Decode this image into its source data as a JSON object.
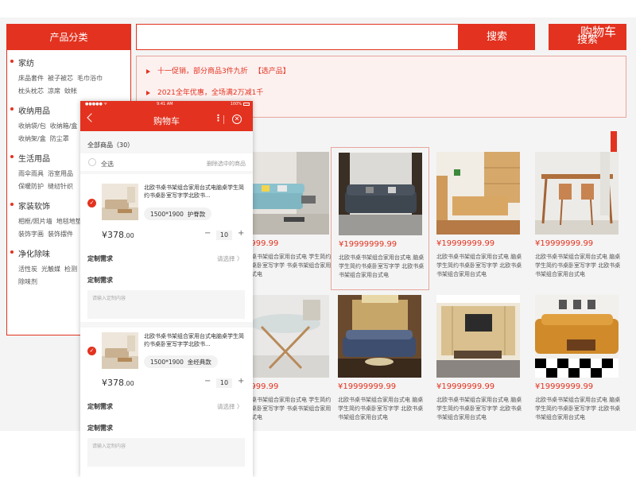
{
  "sidebar": {
    "header": "产品分类",
    "categories": [
      {
        "title": "家纺",
        "rows": [
          [
            "床品套件",
            "被子被芯",
            "毛巾浴巾"
          ],
          [
            "枕头枕芯",
            "凉席",
            "蚊帐"
          ]
        ]
      },
      {
        "title": "收纳用品",
        "rows": [
          [
            "收纳袋/包",
            "收纳箱/盒"
          ],
          [
            "收纳架/盒",
            "防尘罩"
          ]
        ]
      },
      {
        "title": "生活用品",
        "rows": [
          [
            "雨伞雨具",
            "浴室用品"
          ],
          [
            "保暖防护",
            "缝纫针织"
          ]
        ]
      },
      {
        "title": "家装软饰",
        "rows": [
          [
            "相框/照片墙",
            "地毯地垫"
          ],
          [
            "装饰字画",
            "装饰摆件"
          ]
        ]
      },
      {
        "title": "净化除味",
        "rows": [
          [
            "活性炭",
            "光触媒",
            "检测"
          ],
          [
            "除味剂"
          ]
        ]
      }
    ]
  },
  "search": {
    "placeholder": "",
    "button": "搜索"
  },
  "cart_button": {
    "label": "购物车",
    "ghost_label": "搜索"
  },
  "promos": [
    {
      "text": "十一促销，部分商品3件九折",
      "link": "【选产品】"
    },
    {
      "text": "2021全年优惠，全场满2万减1千",
      "link": ""
    }
  ],
  "products": [
    {
      "price": "9999.99",
      "desc": "书桌书架组合家用台式电 学生简约书桌卧室写字学 书桌书架组合家用台式电",
      "photo": "sofa-blue"
    },
    {
      "price": "¥19999999.99",
      "desc": "北欧书桌书架组合家用台式电 脑桌学生简约书桌卧室写字学 北欧书桌书架组合家用台式电",
      "photo": "sofa-dark"
    },
    {
      "price": "¥19999999.99",
      "desc": "北欧书桌书架组合家用台式电 脑桌学生简约书桌卧室写字学 北欧书桌书架组合家用台式电",
      "photo": "wood-cabinet"
    },
    {
      "price": "¥19999999.99",
      "desc": "北欧书桌书架组合家用台式电 脑桌学生简约书桌卧室写字学 北欧书桌书架组合家用台式电",
      "photo": "dining-table"
    },
    {
      "price": "9999.99",
      "desc": "书桌书架组合家用台式电 学生简约书桌卧室写字学 书桌书架组合家用台式电",
      "photo": "glass-table"
    },
    {
      "price": "¥19999999.99",
      "desc": "北欧书桌书架组合家用台式电 脑桌学生简约书桌卧室写字学 北欧书桌书架组合家用台式电",
      "photo": "classic-sofa"
    },
    {
      "price": "¥19999999.99",
      "desc": "北欧书桌书架组合家用台式电 脑桌学生简约书桌卧室写字学 北欧书桌书架组合家用台式电",
      "photo": "tv-cabinet"
    },
    {
      "price": "¥19999999.99",
      "desc": "北欧书桌书架组合家用台式电 脑桌学生简约书桌卧室写字学 北欧书桌书架组合家用台式电",
      "photo": "leather-sofa"
    }
  ],
  "phone": {
    "status": {
      "carrier": "●●●●● ᯤ",
      "time": "9:41 AM",
      "battery": "100%"
    },
    "title": "购物车",
    "more_icon": "⋮",
    "close_icon": "✕",
    "all_items": "全部商品（30）",
    "select_all": "全选",
    "delete_selected": "删除选中的商品",
    "items": [
      {
        "title": "北欧书桌书架组合家用台式电脑桌学生简约书桌卧室写字学北欧书...",
        "spec_size": "1500*1900",
        "spec_style": "护脊款",
        "price_int": "¥378",
        "price_dec": ".00",
        "qty": "10",
        "custom_label": "定制需求",
        "choose": "请选择 〉",
        "custom_label2": "定制需求",
        "input_placeholder": "请输入定制内容"
      },
      {
        "title": "北欧书桌书架组合家用台式电脑桌学生简约书桌卧室写字学北欧书...",
        "spec_size": "1500*1900",
        "spec_style": "金经典款",
        "price_int": "¥378",
        "price_dec": ".00",
        "qty": "10",
        "custom_label": "定制需求",
        "choose": "请选择 〉",
        "custom_label2": "定制需求",
        "input_placeholder": "请输入定制内容"
      }
    ]
  },
  "colors": {
    "accent": "#e3321f",
    "promo_bg": "#fdf1f0"
  }
}
